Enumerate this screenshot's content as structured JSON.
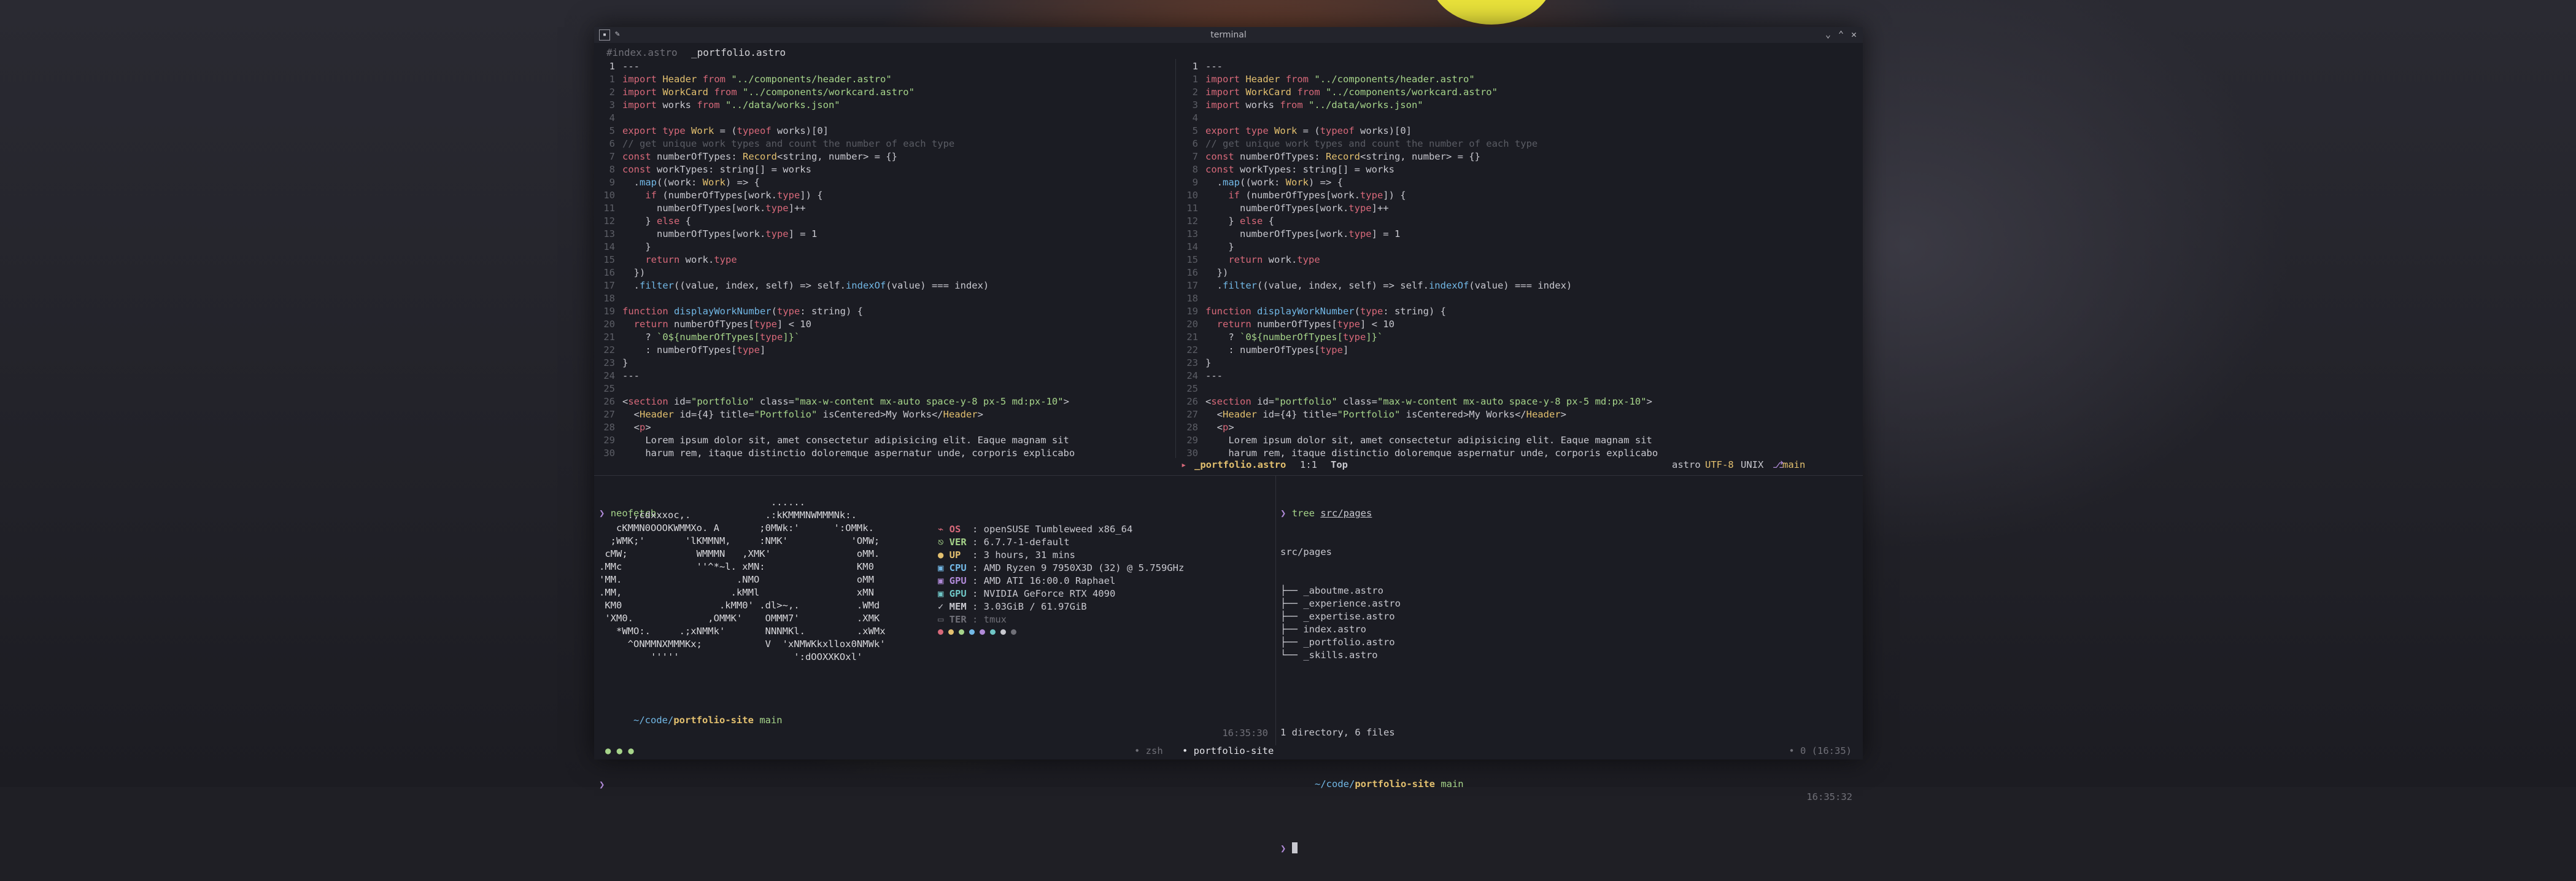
{
  "window": {
    "title": "terminal",
    "controls": [
      "⌄",
      "⌃",
      "✕"
    ],
    "left_icons": [
      "terminal-app-icon",
      "pin-icon"
    ]
  },
  "tabs": [
    {
      "label": "#index.astro",
      "active": false
    },
    {
      "label": "_portfolio.astro",
      "active": true
    }
  ],
  "editor_left": {
    "lines": [
      [
        "1",
        "---"
      ],
      [
        "1",
        "import Header from \"../components/header.astro\""
      ],
      [
        "2",
        "import WorkCard from \"../components/workcard.astro\""
      ],
      [
        "3",
        "import works from \"../data/works.json\""
      ],
      [
        "4",
        ""
      ],
      [
        "5",
        "export type Work = (typeof works)[0]"
      ],
      [
        "6",
        "// get unique work types and count the number of each type"
      ],
      [
        "7",
        "const numberOfTypes: Record<string, number> = {}"
      ],
      [
        "8",
        "const workTypes: string[] = works"
      ],
      [
        "9",
        "  .map((work: Work) => {"
      ],
      [
        "10",
        "    if (numberOfTypes[work.type]) {"
      ],
      [
        "11",
        "      numberOfTypes[work.type]++"
      ],
      [
        "12",
        "    } else {"
      ],
      [
        "13",
        "      numberOfTypes[work.type] = 1"
      ],
      [
        "14",
        "    }"
      ],
      [
        "15",
        "    return work.type"
      ],
      [
        "16",
        "  })"
      ],
      [
        "17",
        "  .filter((value, index, self) => self.indexOf(value) === index)"
      ],
      [
        "18",
        ""
      ],
      [
        "19",
        "function displayWorkNumber(type: string) {"
      ],
      [
        "20",
        "  return numberOfTypes[type] < 10"
      ],
      [
        "21",
        "    ? `0${numberOfTypes[type]}`"
      ],
      [
        "22",
        "    : numberOfTypes[type]"
      ],
      [
        "23",
        "}"
      ],
      [
        "24",
        "---"
      ],
      [
        "25",
        ""
      ],
      [
        "26",
        "<section id=\"portfolio\" class=\"max-w-content mx-auto space-y-8 px-5 md:px-10\">"
      ],
      [
        "27",
        "  <Header id={4} title=\"Portfolio\" isCentered>My Works</Header>"
      ],
      [
        "28",
        "  <p>"
      ],
      [
        "29",
        "    Lorem ipsum dolor sit, amet consectetur adipisicing elit. Eaque magnam sit"
      ],
      [
        "30",
        "    harum rem, itaque distinctio doloremque aspernatur unde, corporis explicabo"
      ]
    ]
  },
  "editor_right": {
    "lines": [
      [
        "1",
        "---"
      ],
      [
        "1",
        "import Header from \"../components/header.astro\""
      ],
      [
        "2",
        "import WorkCard from \"../components/workcard.astro\""
      ],
      [
        "3",
        "import works from \"../data/works.json\""
      ],
      [
        "4",
        ""
      ],
      [
        "5",
        "export type Work = (typeof works)[0]"
      ],
      [
        "6",
        "// get unique work types and count the number of each type"
      ],
      [
        "7",
        "const numberOfTypes: Record<string, number> = {}"
      ],
      [
        "8",
        "const workTypes: string[] = works"
      ],
      [
        "9",
        "  .map((work: Work) => {"
      ],
      [
        "10",
        "    if (numberOfTypes[work.type]) {"
      ],
      [
        "11",
        "      numberOfTypes[work.type]++"
      ],
      [
        "12",
        "    } else {"
      ],
      [
        "13",
        "      numberOfTypes[work.type] = 1"
      ],
      [
        "14",
        "    }"
      ],
      [
        "15",
        "    return work.type"
      ],
      [
        "16",
        "  })"
      ],
      [
        "17",
        "  .filter((value, index, self) => self.indexOf(value) === index)"
      ],
      [
        "18",
        ""
      ],
      [
        "19",
        "function displayWorkNumber(type: string) {"
      ],
      [
        "20",
        "  return numberOfTypes[type] < 10"
      ],
      [
        "21",
        "    ? `0${numberOfTypes[type]}`"
      ],
      [
        "22",
        "    : numberOfTypes[type]"
      ],
      [
        "23",
        "}"
      ],
      [
        "24",
        "---"
      ],
      [
        "25",
        ""
      ],
      [
        "26",
        "<section id=\"portfolio\" class=\"max-w-content mx-auto space-y-8 px-5 md:px-10\">"
      ],
      [
        "27",
        "  <Header id={4} title=\"Portfolio\" isCentered>My Works</Header>"
      ],
      [
        "28",
        "  <p>"
      ],
      [
        "29",
        "    Lorem ipsum dolor sit, amet consectetur adipisicing elit. Eaque magnam sit"
      ],
      [
        "30",
        "    harum rem, itaque distinctio doloremque aspernatur unde, corporis explicabo"
      ]
    ]
  },
  "statusline": {
    "mode_icon": "▸",
    "filename": "_portfolio.astro",
    "position": "1:1",
    "scroll": "Top",
    "filetype": "astro",
    "encoding": "UTF-8",
    "format": "UNIX",
    "branch": "main",
    "branch_icon": "⎇"
  },
  "neofetch": {
    "command": "neofetch",
    "prompt_symbol": "❯",
    "art": [
      "                              ......",
      "     .,cdxxxoc,.             .:kKMMMNWMMMNk:.",
      "   cKMMN0OOOKWMMXo. A       ;0MWk:'      ':OMMk.",
      "  ;WMK;'       'lKMMNM,     :NMK'           'OMW;",
      " cMW;            WMMMN   ,XMK'               oMM.",
      ".MMc             ''^*~l. xMN:                KM0",
      "'MM.                    .NMO                 oMM",
      ".MM,                   .kMMl                 xMN",
      " KM0                 .kMM0' .dl>~,.          .WMd",
      " 'XM0.             ,OMMK'    OMMM7'          .XMK",
      "   *WMO:.     .;xNMMk'       NNNMKl.         .xWMx",
      "     ^ONMMNXMMMKx;           V  'xNMWKkxllox0NMWk'",
      "         '''''                    ':dOOXXKOxl'"
    ],
    "info": [
      {
        "label": "OS",
        "value": ": openSUSE Tumbleweed x86_64",
        "icon": "⌁",
        "color": "red"
      },
      {
        "label": "VER",
        "value": ": 6.7.7-1-default",
        "icon": "⎋",
        "color": "g"
      },
      {
        "label": "UP",
        "value": ": 3 hours, 31 mins",
        "icon": "●",
        "color": "y"
      },
      {
        "label": "CPU",
        "value": ": AMD Ryzen 9 7950X3D (32) @ 5.759GHz",
        "icon": "▣",
        "color": "b"
      },
      {
        "label": "GPU",
        "value": ": AMD ATI 16:00.0 Raphael",
        "icon": "▣",
        "color": "p"
      },
      {
        "label": "GPU",
        "value": ": NVIDIA GeForce RTX 4090",
        "icon": "▣",
        "color": "c"
      },
      {
        "label": "MEM",
        "value": ": 3.03GiB / 61.97GiB",
        "icon": "✓",
        "color": "w"
      },
      {
        "label": "TER",
        "value": ": tmux",
        "icon": "▭",
        "color": "dim"
      }
    ],
    "palette": [
      "#d8697a",
      "#e3c06f",
      "#a6d48a",
      "#72b8e6",
      "#b08ad8",
      "#6fc6c6",
      "#c8c8cf",
      "#707078"
    ]
  },
  "left_term_prompt": {
    "home": "~/code/",
    "dir": "portfolio-site",
    "branch": " main",
    "time": "16:35:30",
    "next_prompt": "❯"
  },
  "tree_term": {
    "prompt_symbol": "❯",
    "command": "tree",
    "arg": "src/pages",
    "root": "src/pages",
    "entries": [
      "├── _aboutme.astro",
      "├── _experience.astro",
      "├── _expertise.astro",
      "├── index.astro",
      "├── _portfolio.astro",
      "└── _skills.astro"
    ],
    "summary": "1 directory, 6 files",
    "home": "~/code/",
    "dir": "portfolio-site",
    "branch": " main",
    "time": "16:35:32",
    "next_prompt": "❯"
  },
  "tmux": {
    "left": "● ● ●",
    "window_inactive": "• zsh",
    "window_active": "• portfolio-site",
    "right": "• 0 (16:35)"
  }
}
